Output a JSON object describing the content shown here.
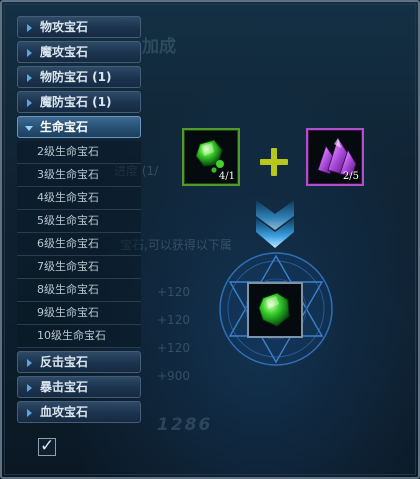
{
  "categories_top": [
    {
      "label": "物攻宝石"
    },
    {
      "label": "魔攻宝石"
    },
    {
      "label": "物防宝石 (1)"
    },
    {
      "label": "魔防宝石 (1)"
    }
  ],
  "open_category": {
    "label": "生命宝石",
    "items": [
      "2级生命宝石",
      "3级生命宝石",
      "4级生命宝石",
      "5级生命宝石",
      "6级生命宝石",
      "7级生命宝石",
      "8级生命宝石",
      "9级生命宝石",
      "10级生命宝石"
    ]
  },
  "categories_bottom": [
    {
      "label": "反击宝石"
    },
    {
      "label": "暴击宝石"
    },
    {
      "label": "血攻宝石"
    }
  ],
  "slots": {
    "green_gem_count": "4/1",
    "purple_gem_count": "2/5"
  },
  "background_text": {
    "heading": "加成",
    "progress": "进度 (1/",
    "hint": "宝石,可以获得以下属",
    "stats": [
      "+120",
      "+120",
      "+120",
      "+900"
    ],
    "power": "1286"
  },
  "colors": {
    "green_border": "#4f9b29",
    "purple_border": "#b04ecc",
    "accent_blue": "#5fa3e0",
    "plus_yellow": "#b8c81a"
  }
}
